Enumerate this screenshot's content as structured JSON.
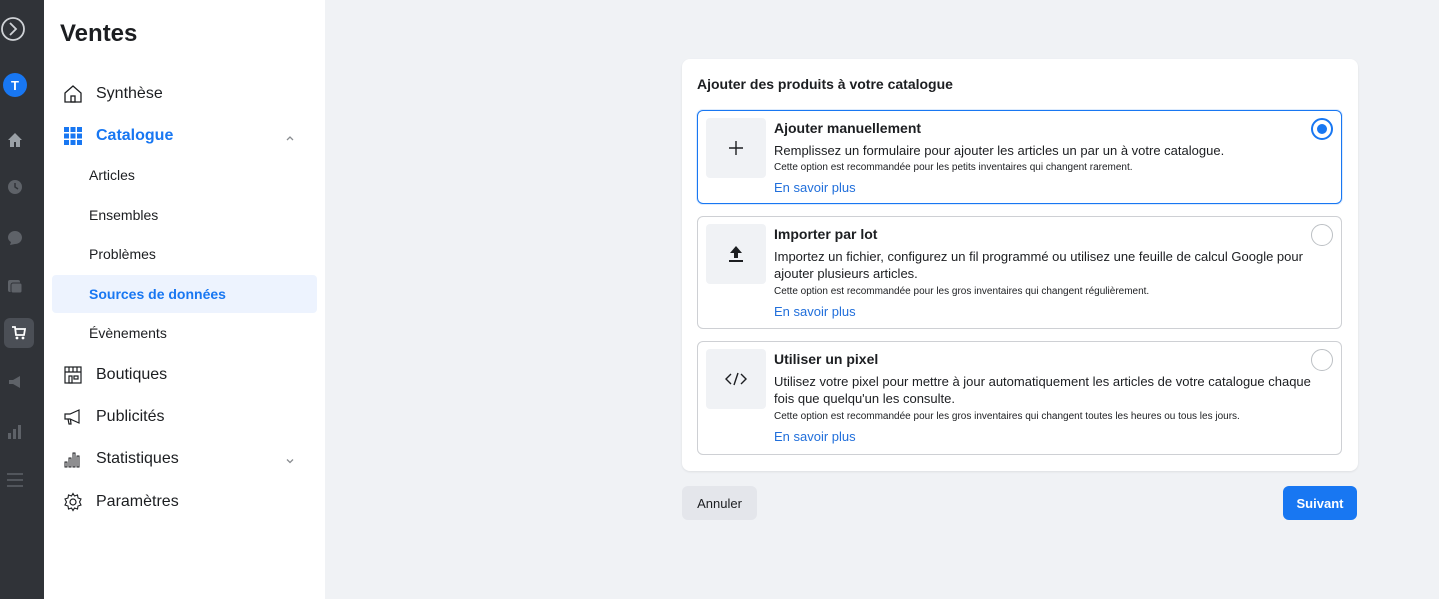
{
  "rail": {
    "avatar_initial": "T",
    "icons": [
      "compass-icon",
      "avatar",
      "home-icon",
      "clock-icon",
      "chat-icon",
      "pages-icon",
      "shop-cart-icon",
      "megaphone-icon",
      "bar-chart-icon",
      "menu-icon"
    ]
  },
  "sidebar": {
    "title": "Ventes",
    "items": [
      {
        "label": "Synthèse",
        "icon": "home-outline-icon"
      },
      {
        "label": "Catalogue",
        "icon": "grid-icon"
      },
      {
        "label": "Boutiques",
        "icon": "storefront-icon"
      },
      {
        "label": "Publicités",
        "icon": "megaphone-outline-icon"
      },
      {
        "label": "Statistiques",
        "icon": "bar-chart-outline-icon"
      },
      {
        "label": "Paramètres",
        "icon": "gear-icon"
      }
    ],
    "catalogue_sub": [
      {
        "label": "Articles"
      },
      {
        "label": "Ensembles"
      },
      {
        "label": "Problèmes"
      },
      {
        "label": "Sources de données"
      },
      {
        "label": "Évènements"
      }
    ]
  },
  "card": {
    "title": "Ajouter des produits à votre catalogue",
    "options": [
      {
        "title": "Ajouter manuellement",
        "desc": "Remplissez un formulaire pour ajouter les articles un par un à votre catalogue.",
        "note": "Cette option est recommandée pour les petits inventaires qui changent rarement.",
        "link": "En savoir plus",
        "icon": "plus-icon",
        "selected": true
      },
      {
        "title": "Importer par lot",
        "desc": "Importez un fichier, configurez un fil programmé ou utilisez une feuille de calcul Google pour ajouter plusieurs articles.",
        "note": "Cette option est recommandée pour les gros inventaires qui changent régulièrement.",
        "link": "En savoir plus",
        "icon": "upload-icon",
        "selected": false
      },
      {
        "title": "Utiliser un pixel",
        "desc": "Utilisez votre pixel pour mettre à jour automatiquement les articles de votre catalogue chaque fois que quelqu'un les consulte.",
        "note": "Cette option est recommandée pour les gros inventaires qui changent toutes les heures ou tous les jours.",
        "link": "En savoir plus",
        "icon": "code-icon",
        "selected": false
      }
    ]
  },
  "footer": {
    "cancel_label": "Annuler",
    "next_label": "Suivant"
  },
  "colors": {
    "accent": "#1877f2",
    "rail_bg": "#303338",
    "page_bg": "#f0f2f5"
  }
}
